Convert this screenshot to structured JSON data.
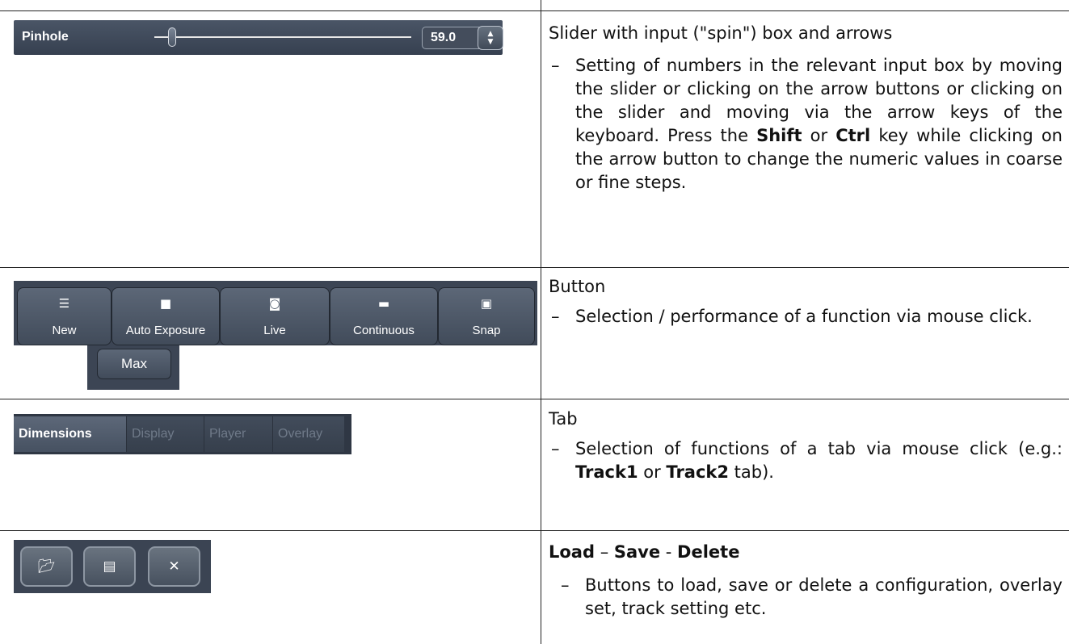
{
  "slider_row": {
    "label": "Pinhole",
    "value": "59.0",
    "slider_position": 0.07,
    "title": "Slider with input (\"spin\") box and arrows",
    "desc_a": "Setting of numbers in the relevant input box by moving the slider or clicking on the arrow buttons or clicking on the slider and moving via the arrow keys of the keyboard. Press the ",
    "shift": "Shift",
    "desc_b": " or ",
    "ctrl": "Ctrl",
    "desc_c": " key while clicking on the arrow button to change the numeric values in coarse or fine steps."
  },
  "button_row": {
    "buttons": [
      {
        "label": "New",
        "icon": "menu-lines-icon"
      },
      {
        "label": "Auto Exposure",
        "icon": "camera-icon"
      },
      {
        "label": "Live",
        "icon": "live-video-icon"
      },
      {
        "label": "Continuous",
        "icon": "video-camera-icon"
      },
      {
        "label": "Snap",
        "icon": "snap-camera-icon"
      }
    ],
    "max_label": "Max",
    "title": "Button",
    "desc": "Selection / performance of a function via mouse click."
  },
  "tab_row": {
    "tabs": [
      "Dimensions",
      "Display",
      "Player",
      "Overlay"
    ],
    "title": "Tab",
    "desc_a": "Selection of functions of a tab via mouse click (e.g.: ",
    "track1": "Track1",
    "desc_b": " or ",
    "track2": "Track2",
    "desc_c": " tab)."
  },
  "lsd_row": {
    "icons": [
      "folder-open-icon",
      "save-disk-icon",
      "close-icon"
    ],
    "title_load": "Load",
    "sep1": " – ",
    "title_save": "Save",
    "sep2": " - ",
    "title_delete": "Delete",
    "desc": "Buttons to load, save or delete a configuration, overlay set, track setting etc."
  },
  "dash": "–",
  "colors": {
    "widget_bg": "#3c4554",
    "text": "#111111"
  }
}
